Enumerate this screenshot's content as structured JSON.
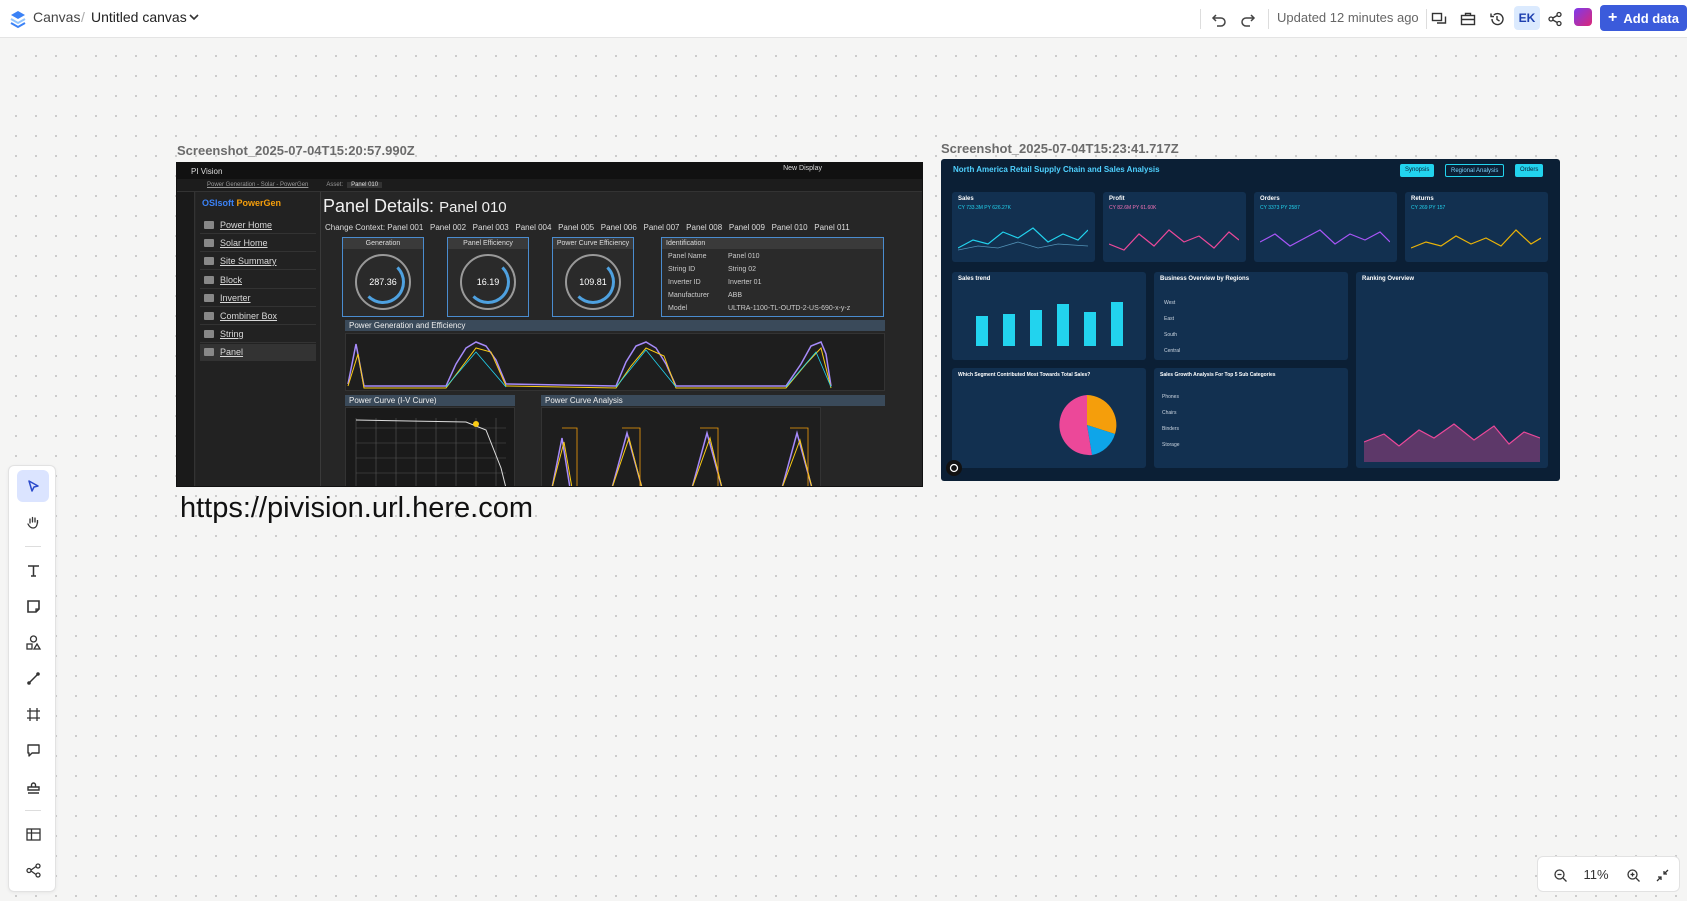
{
  "header": {
    "root": "Canvas",
    "separator": "/",
    "title": "Untitled canvas",
    "updated": "Updated 12 minutes ago",
    "avatar": "EK",
    "add_data": "Add data",
    "accent": "#3b5bdb"
  },
  "images": [
    {
      "caption": "Screenshot_2025-07-04T15:20:57.990Z",
      "app": "PI Vision",
      "new_display": "New Display",
      "breadcrumb": "Power Generation - Solar - PowerGen",
      "asset_label": "Asset:",
      "asset_value": "Panel 010",
      "brand_os": "OSIsoft",
      "brand": "PowerGen",
      "title": "Panel Details:",
      "title_panel": "Panel 010",
      "context_label": "Change Context:",
      "context_panels": "Panel 001   Panel 002   Panel 003   Panel 004   Panel 005   Panel 006   Panel 007   Panel 008   Panel 009   Panel 010   Panel 011",
      "nav": [
        "Power Home",
        "Solar Home",
        "Site Summary",
        "Block",
        "Inverter",
        "Combiner Box",
        "String",
        "Panel"
      ],
      "gauges": [
        {
          "label": "Generation",
          "value": "287.36"
        },
        {
          "label": "Panel Efficiency",
          "value": "16.19"
        },
        {
          "label": "Power Curve Efficiency",
          "value": "109.81"
        }
      ],
      "identification": {
        "header": "Identification",
        "rows": [
          {
            "k": "Panel Name",
            "v": "Panel 010"
          },
          {
            "k": "String ID",
            "v": "String 02"
          },
          {
            "k": "Inverter ID",
            "v": "Inverter 01"
          },
          {
            "k": "Manufacturer",
            "v": "ABB"
          },
          {
            "k": "Model",
            "v": "ULTRA-1100-TL-OUTD-2-US-690-x-y-z"
          }
        ]
      },
      "sections": [
        "Power Generation and Efficiency",
        "Power Curve (I-V Curve)",
        "Power Curve Analysis"
      ]
    },
    {
      "caption": "Screenshot_2025-07-04T15:23:41.717Z",
      "title": "North America Retail Supply Chain and Sales Analysis",
      "buttons": [
        "Synopsis",
        "Regional Analysis",
        "Orders"
      ],
      "kpis": [
        {
          "label": "Sales",
          "value": "CY 733.3M   PY 626.27K"
        },
        {
          "label": "Profit",
          "value": "CY 82.6M   PY 61.60K"
        },
        {
          "label": "Orders",
          "value": "CY 3373   PY 2587"
        },
        {
          "label": "Returns",
          "value": "CY 269   PY 157"
        }
      ],
      "panels": [
        "Sales trend",
        "Business Overview by Regions",
        "Ranking Overview",
        "Which Segment Contributed Most Towards Total Sales?",
        "Sales Growth Analysis For Top 5 Sub Categories"
      ],
      "years": [
        "2019",
        "2020",
        "2021",
        "2022",
        "2023",
        "2024"
      ],
      "regions": [
        "West",
        "East",
        "South",
        "Central"
      ],
      "subcats": [
        "Phones",
        "Chairs",
        "Binders",
        "Storage"
      ]
    }
  ],
  "url_note": "https://pivision.url.here.com",
  "zoom": {
    "level": "11%"
  },
  "tools": [
    "select",
    "hand",
    "text",
    "sticky-note",
    "shapes",
    "connector",
    "frame",
    "comment",
    "stamp",
    "table",
    "diagram"
  ]
}
